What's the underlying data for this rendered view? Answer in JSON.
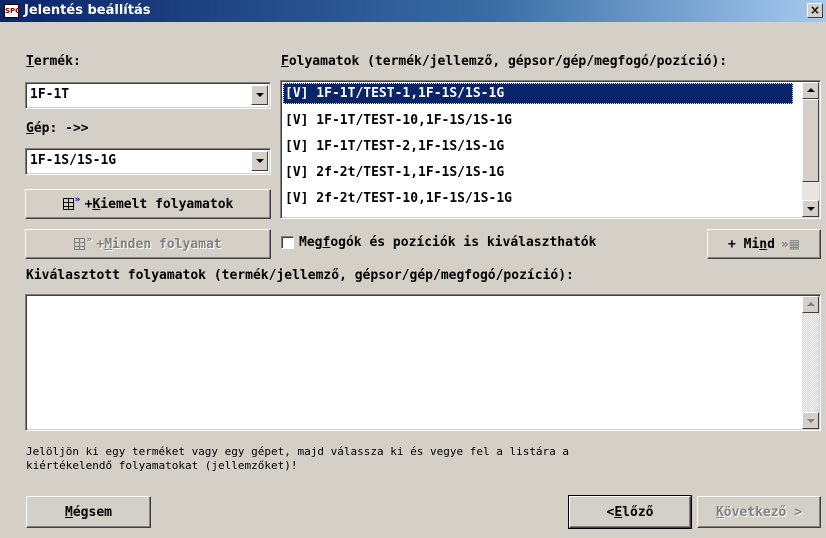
{
  "window": {
    "app_icon_text": "SPC",
    "title": "Jelentés beállítás",
    "close_glyph": "×"
  },
  "left": {
    "product_label_u": "T",
    "product_label_rest": "ermék:",
    "product_value": "1F-1T",
    "machine_label_u": "G",
    "machine_label_rest": "ép: ->>",
    "machine_value": "1F-1S/1S-1G",
    "highlighted_button_prefix": "+ ",
    "highlighted_button_u": "K",
    "highlighted_button_rest": "iemelt folyamatok",
    "all_button_prefix": "+ ",
    "all_button_u": "M",
    "all_button_rest": "inden folyamat"
  },
  "processes": {
    "label_u": "F",
    "label_rest": "olyamatok (termék/jellemző, gépsor/gép/megfogó/pozíció):",
    "items": [
      "[V] 1F-1T/TEST-1,1F-1S/1S-1G",
      "[V] 1F-1T/TEST-10,1F-1S/1S-1G",
      "[V] 1F-1T/TEST-2,1F-1S/1S-1G",
      "[V] 2f-2t/TEST-1,1F-1S/1S-1G",
      "[V] 2f-2t/TEST-10,1F-1S/1S-1G"
    ],
    "selected_index": 0
  },
  "options": {
    "grippers_checkbox_pre": "Meg",
    "grippers_checkbox_u": "f",
    "grippers_checkbox_rest": "ogók és pozíciók is kiválaszthatók",
    "grippers_checked": false,
    "add_all_prefix": "+ Mi",
    "add_all_u": "n",
    "add_all_rest": "d"
  },
  "selected_list": {
    "label": "Kiválasztott folyamatok (termék/jellemző, gépsor/gép/megfogó/pozíció):",
    "items": []
  },
  "hint": {
    "line1": "Jelöljön ki egy terméket vagy egy gépet, majd válassza ki és vegye fel a listára a",
    "line2": "kiértékelendő folyamatokat (jellemzőket)!"
  },
  "footer": {
    "cancel_u": "M",
    "cancel_rest": "égsem",
    "prev_prefix": "< ",
    "prev_u": "E",
    "prev_rest": "lőző",
    "next_u": "K",
    "next_rest": "övetkező >"
  },
  "colors": {
    "dialog_bg": "#d4d0c8",
    "title_active": "#0a246a",
    "selection": "#0a246a",
    "disabled_text": "#808080"
  },
  "icons": [
    "spc-app-icon",
    "close-icon",
    "dropdown-arrow-icon",
    "process-list-icon",
    "scroll-up-icon",
    "scroll-down-icon",
    "add-all-icon"
  ]
}
